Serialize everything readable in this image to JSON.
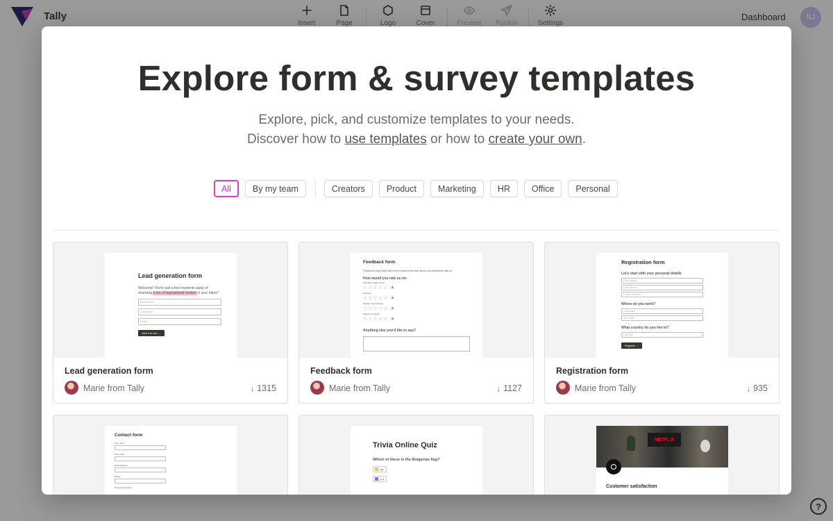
{
  "app": {
    "name": "Tally",
    "dashboard_label": "Dashboard",
    "avatar_initials": "SJ",
    "help_label": "?"
  },
  "toolbar": [
    {
      "label": "Insert",
      "icon": "plus-icon",
      "disabled": false
    },
    {
      "label": "Page",
      "icon": "page-icon",
      "disabled": false
    },
    {
      "label": "Logo",
      "icon": "hexagon-icon",
      "disabled": false
    },
    {
      "label": "Cover",
      "icon": "cover-icon",
      "disabled": false
    },
    {
      "label": "Preview",
      "icon": "eye-icon",
      "disabled": true
    },
    {
      "label": "Publish",
      "icon": "send-icon",
      "disabled": true
    },
    {
      "label": "Settings",
      "icon": "gear-icon",
      "disabled": false
    }
  ],
  "modal": {
    "title": "Explore form & survey templates",
    "subtitle_line1": "Explore, pick, and customize templates to your needs.",
    "subtitle_pre": "Discover how to ",
    "link_use": "use templates",
    "subtitle_mid": " or how to ",
    "link_create": "create your own",
    "subtitle_end": "."
  },
  "filters": {
    "all": "All",
    "team": "By my team",
    "categories": [
      "Creators",
      "Product",
      "Marketing",
      "HR",
      "Office",
      "Personal"
    ],
    "active": "All"
  },
  "templates": [
    {
      "title": "Lead generation form",
      "author": "Marie from Tally",
      "downloads": "1315",
      "preview": {
        "heading": "Lead generation form",
        "text_a": "Welcome! You're just a few moments away of receiving ",
        "highlight": "a ton of inspirational content",
        "text_b": " in your inbox!",
        "fields": [
          "First name",
          "Last name",
          "Email"
        ],
        "button": "Give it to me →"
      }
    },
    {
      "title": "Feedback form",
      "author": "Marie from Tally",
      "downloads": "1127",
      "preview": {
        "heading": "Feedback form",
        "intro": "Thanks for using Tally! We'd love to know a bit more about your experience with us.",
        "question": "How would you rate us on:",
        "ratings": [
          "Simplicity / Ease of use",
          "Features",
          "Design / look and feel",
          "Support / Contact"
        ],
        "stars": "☆☆☆☆☆ ★",
        "open_question": "Anything else you'd like to say?"
      }
    },
    {
      "title": "Registration form",
      "author": "Marie from Tally",
      "downloads": "935",
      "preview": {
        "heading": "Registration form",
        "section1": "Let's start with your personal details",
        "fields1": [
          "First name",
          "Last Name",
          "Email address"
        ],
        "section2": "Where do you work?",
        "fields2": [
          "Company",
          "Job Title"
        ],
        "section3": "What country do you live in?",
        "fields3": [
          "Country"
        ],
        "button": "Register →"
      }
    },
    {
      "title": "Contact form",
      "preview": {
        "heading": "Contact form",
        "fields": [
          "First name",
          "Last name",
          "Email address",
          "Phone",
          "How can we help?"
        ]
      }
    },
    {
      "title": "Trivia Online Quiz",
      "preview": {
        "heading": "Trivia Online Quiz",
        "question": "Which of these is the Bulgarian flag?",
        "options": [
          "sd",
          "y 2"
        ]
      }
    },
    {
      "title": "Customer satisfaction",
      "preview": {
        "heading": "Customer satisfaction",
        "banner_brand": "NETFLIX"
      }
    }
  ],
  "colors": {
    "accent": "#e03ac7",
    "avatar_bg": "#c9c4f4",
    "overlay": "rgba(15,15,15,0.42)"
  }
}
